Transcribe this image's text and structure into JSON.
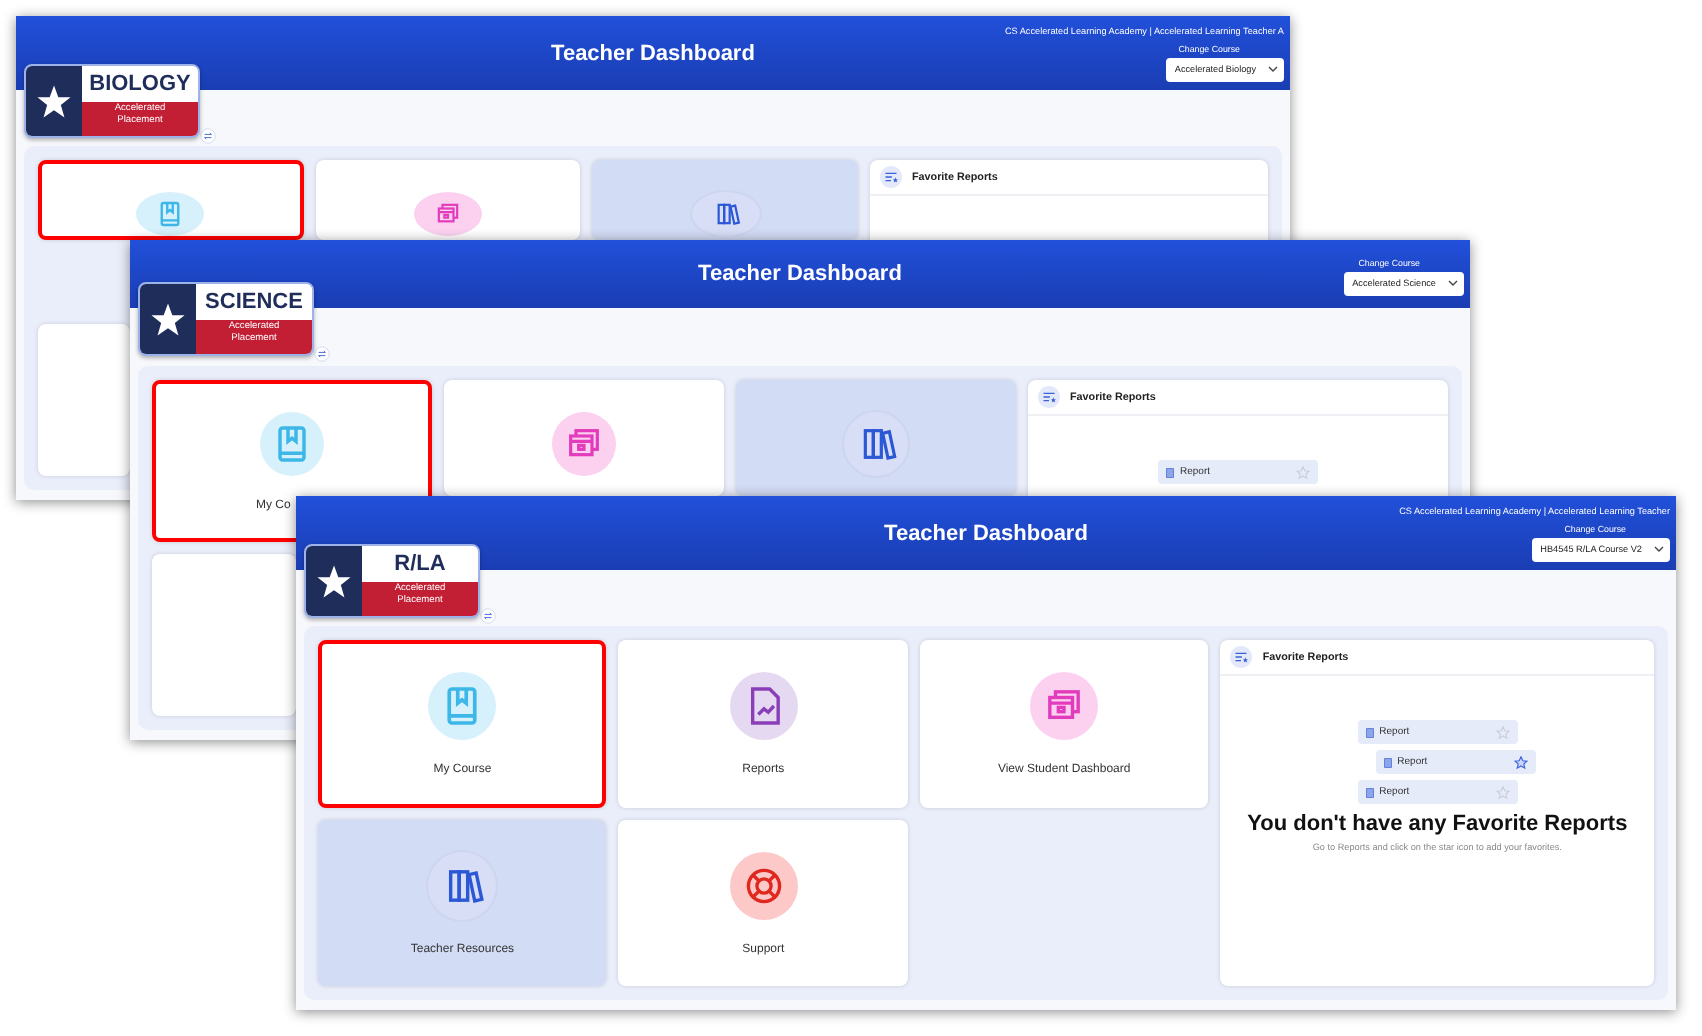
{
  "windows": [
    {
      "title": "Teacher Dashboard",
      "account": "CS Accelerated Learning Academy | Accelerated Learning Teacher A",
      "change_course_label": "Change Course",
      "course": "Accelerated Biology",
      "logo": {
        "subject": "BIOLOGY",
        "tagline": "Accelerated Placement"
      },
      "tiles": [
        {
          "kind": "course",
          "highlighted": true,
          "active": false
        },
        {
          "kind": "student",
          "highlighted": false,
          "active": false
        },
        {
          "kind": "resources",
          "highlighted": false,
          "active": true
        },
        {
          "kind": "blank",
          "highlighted": false,
          "active": false
        }
      ],
      "favorites": {
        "title": "Favorite Reports"
      }
    },
    {
      "title": "Teacher Dashboard",
      "change_course_label": "Change Course",
      "course": "Accelerated Science",
      "logo": {
        "subject": "SCIENCE",
        "tagline": "Accelerated Placement"
      },
      "tiles": [
        {
          "kind": "course",
          "label": "My Co",
          "highlighted": true,
          "active": false
        },
        {
          "kind": "student",
          "highlighted": false,
          "active": false
        },
        {
          "kind": "resources",
          "highlighted": false,
          "active": true
        },
        {
          "kind": "blank",
          "highlighted": false,
          "active": false
        }
      ],
      "favorites": {
        "title": "Favorite Reports",
        "reports": [
          {
            "label": "Report",
            "starred": false
          }
        ]
      }
    },
    {
      "title": "Teacher Dashboard",
      "account": "CS Accelerated Learning Academy | Accelerated Learning Teacher",
      "change_course_label": "Change Course",
      "course": "HB4545 R/LA Course V2",
      "logo": {
        "subject": "R/LA",
        "tagline": "Accelerated Placement"
      },
      "tiles": [
        {
          "kind": "course",
          "label": "My Course",
          "highlighted": true,
          "active": false
        },
        {
          "kind": "reports",
          "label": "Reports",
          "highlighted": false,
          "active": false
        },
        {
          "kind": "student",
          "label": "View Student Dashboard",
          "highlighted": false,
          "active": false
        },
        {
          "kind": "resources",
          "label": "Teacher Resources",
          "highlighted": false,
          "active": true
        },
        {
          "kind": "support",
          "label": "Support",
          "highlighted": false,
          "active": false
        }
      ],
      "favorites": {
        "title": "Favorite Reports",
        "reports": [
          {
            "label": "Report",
            "starred": false
          },
          {
            "label": "Report",
            "starred": true
          },
          {
            "label": "Report",
            "starred": false
          }
        ],
        "empty_title": "You don't have any Favorite Reports",
        "empty_hint": "Go to Reports and click on the star icon to add your favorites."
      }
    }
  ]
}
